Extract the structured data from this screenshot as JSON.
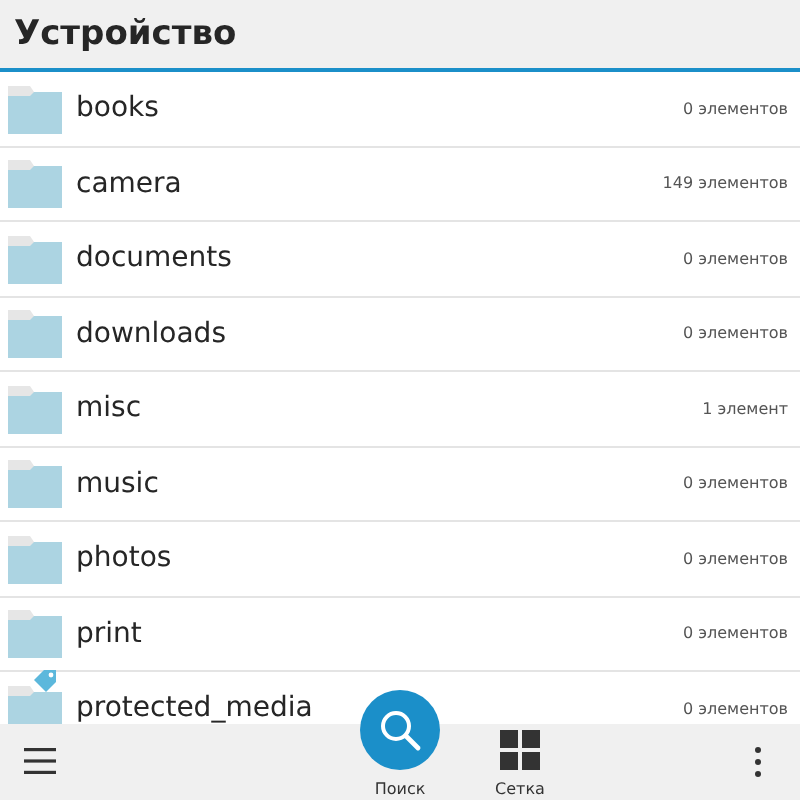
{
  "header": {
    "title": "Устройство"
  },
  "folders": [
    {
      "name": "books",
      "count": "0 элементов",
      "protected": false
    },
    {
      "name": "camera",
      "count": "149 элементов",
      "protected": false
    },
    {
      "name": "documents",
      "count": "0 элементов",
      "protected": false
    },
    {
      "name": "downloads",
      "count": "0 элементов",
      "protected": false
    },
    {
      "name": "misc",
      "count": "1 элемент",
      "protected": false
    },
    {
      "name": "music",
      "count": "0 элементов",
      "protected": false
    },
    {
      "name": "photos",
      "count": "0 элементов",
      "protected": false
    },
    {
      "name": "print",
      "count": "0 элементов",
      "protected": false
    },
    {
      "name": "protected_media",
      "count": "0 элементов",
      "protected": true
    }
  ],
  "action_bar": {
    "search_label": "Поиск",
    "grid_label": "Сетка"
  }
}
